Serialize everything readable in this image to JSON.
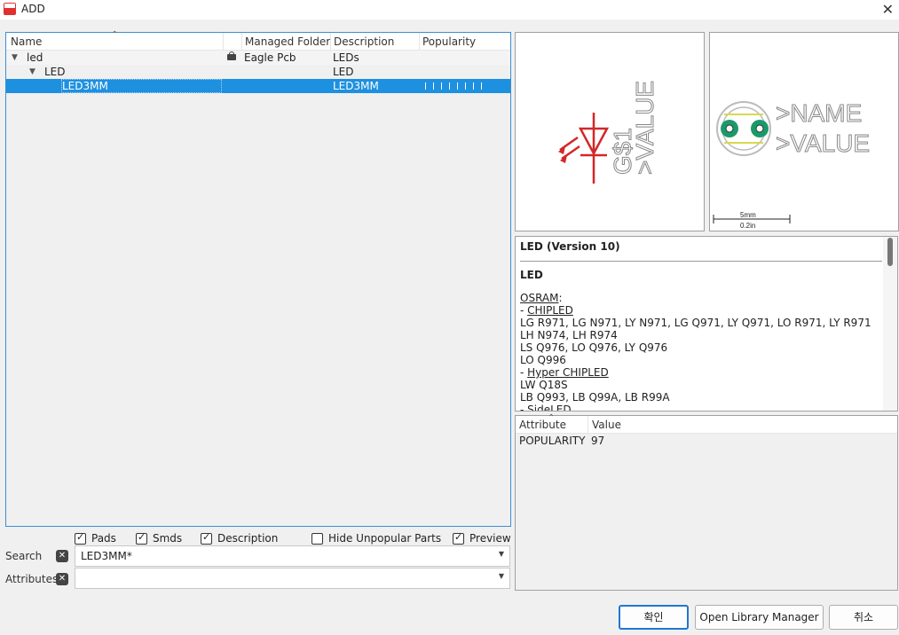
{
  "window": {
    "title": "ADD",
    "close_glyph": "✕"
  },
  "tree": {
    "columns": {
      "name": "Name",
      "managed_folder": "Managed Folder",
      "description": "Description",
      "popularity": "Popularity"
    },
    "rows": [
      {
        "name": "led",
        "managed_folder": "Eagle Pcb",
        "description": "LEDs",
        "caret": "▼"
      },
      {
        "name": "LED",
        "managed_folder": "",
        "description": "LED",
        "caret": "▼"
      },
      {
        "name": "LED3MM",
        "managed_folder": "",
        "description": "LED3MM",
        "popularity": 0.97
      }
    ]
  },
  "options": {
    "pads": {
      "label": "Pads",
      "checked": true
    },
    "smds": {
      "label": "Smds",
      "checked": true
    },
    "description": {
      "label": "Description",
      "checked": true
    },
    "hide_unpopular": {
      "label": "Hide Unpopular Parts",
      "checked": false
    },
    "preview": {
      "label": "Preview",
      "checked": true
    }
  },
  "search": {
    "label": "Search",
    "value": "LED3MM*"
  },
  "attributes": {
    "label": "Attributes",
    "value": ""
  },
  "symbol_preview": {
    "name": "G$1",
    "value": ">VALUE"
  },
  "package_preview": {
    "name": ">NAME",
    "value": ">VALUE",
    "scale_mm": "5mm",
    "scale_in": "0.2in"
  },
  "description_panel": {
    "title": "LED (Version 10)",
    "subtitle": "LED",
    "lines": [
      {
        "text": "OSRAM",
        "suffix": ":",
        "underline": true
      },
      {
        "prefix": "- ",
        "text": "CHIPLED",
        "underline": true
      },
      {
        "text": "LG R971, LG N971, LY N971, LG Q971, LY Q971, LO R971, LY R971 LH N974, LH R974"
      },
      {
        "text": "LS Q976, LO Q976, LY Q976"
      },
      {
        "text": "LO Q996"
      },
      {
        "prefix": "- ",
        "text": "Hyper CHIPLED",
        "underline": true
      },
      {
        "text": "LW Q18S"
      },
      {
        "text": "LB Q993, LB Q99A, LB R99A"
      },
      {
        "prefix": "- ",
        "text": "SideLED",
        "underline": true
      }
    ]
  },
  "attributes_panel": {
    "columns": {
      "attribute": "Attribute",
      "value": "Value"
    },
    "rows": [
      {
        "attribute": "POPULARITY",
        "value": "97"
      }
    ]
  },
  "buttons": {
    "ok": "확인",
    "library_manager": "Open Library Manager",
    "cancel": "취소"
  },
  "colors": {
    "accent": "#1e90e0",
    "symbol_red": "#d22828",
    "pad_green": "#1a9a6a",
    "pad_yellow": "#d8d850"
  }
}
